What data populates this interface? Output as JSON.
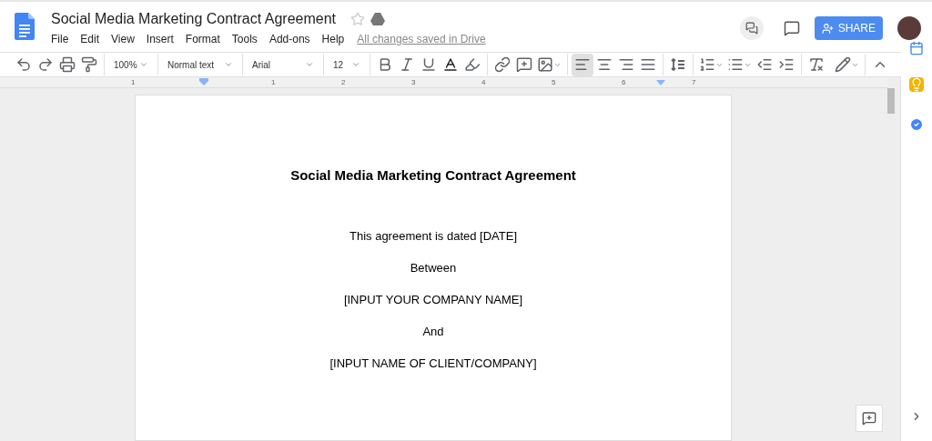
{
  "document_title": "Social Media Marketing Contract Agreement",
  "menu": [
    "File",
    "Edit",
    "View",
    "Insert",
    "Format",
    "Tools",
    "Add-ons",
    "Help"
  ],
  "save_status": "All changes saved in Drive",
  "share_button": "SHARE",
  "toolbar": {
    "zoom": "100%",
    "style": "Normal text",
    "font": "Arial",
    "size": "12",
    "align_buttons": [
      {
        "kind": "left",
        "selected": true
      },
      {
        "kind": "center",
        "selected": false
      },
      {
        "kind": "right",
        "selected": false
      },
      {
        "kind": "justify",
        "selected": false
      }
    ]
  },
  "ruler_labels": [
    "1",
    "1",
    "2",
    "3",
    "4",
    "5",
    "6",
    "7"
  ],
  "page": {
    "heading": "Social Media Marketing Contract Agreement",
    "lines": [
      "This agreement is dated [DATE]",
      "Between",
      "[INPUT YOUR COMPANY NAME]",
      "And",
      "[INPUT NAME OF CLIENT/COMPANY]"
    ]
  }
}
